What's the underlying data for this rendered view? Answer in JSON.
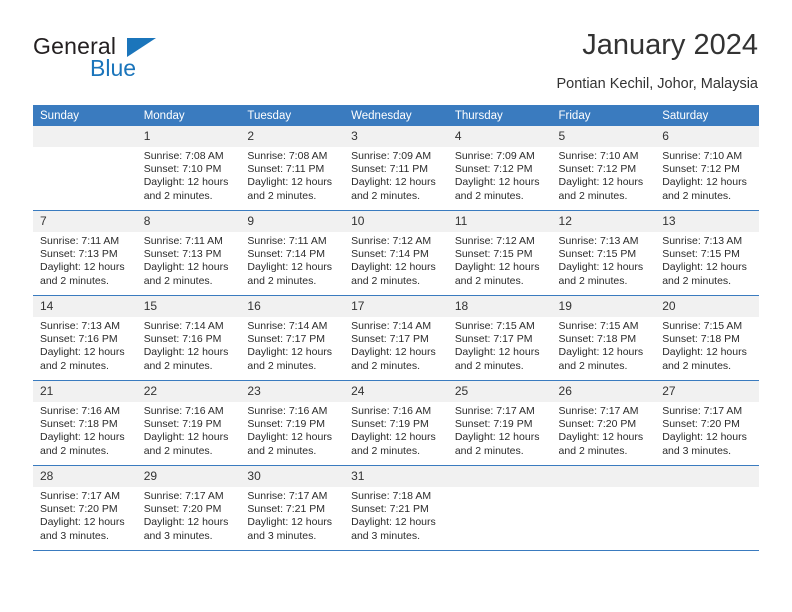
{
  "brand": {
    "name_part1": "General",
    "name_part2": "Blue",
    "triangle_icon": "triangle-icon",
    "accent_color": "#1b75bb"
  },
  "header": {
    "title": "January 2024",
    "subtitle": "Pontian Kechil, Johor, Malaysia"
  },
  "calendar": {
    "header_color": "#3a7bbf",
    "daynum_background": "#f1f1f1",
    "weekday_headers": [
      "Sunday",
      "Monday",
      "Tuesday",
      "Wednesday",
      "Thursday",
      "Friday",
      "Saturday"
    ],
    "weeks": [
      [
        {
          "day": "",
          "sunrise": "",
          "sunset": "",
          "daylight_line1": "",
          "daylight_line2": ""
        },
        {
          "day": "1",
          "sunrise": "Sunrise: 7:08 AM",
          "sunset": "Sunset: 7:10 PM",
          "daylight_line1": "Daylight: 12 hours",
          "daylight_line2": "and 2 minutes."
        },
        {
          "day": "2",
          "sunrise": "Sunrise: 7:08 AM",
          "sunset": "Sunset: 7:11 PM",
          "daylight_line1": "Daylight: 12 hours",
          "daylight_line2": "and 2 minutes."
        },
        {
          "day": "3",
          "sunrise": "Sunrise: 7:09 AM",
          "sunset": "Sunset: 7:11 PM",
          "daylight_line1": "Daylight: 12 hours",
          "daylight_line2": "and 2 minutes."
        },
        {
          "day": "4",
          "sunrise": "Sunrise: 7:09 AM",
          "sunset": "Sunset: 7:12 PM",
          "daylight_line1": "Daylight: 12 hours",
          "daylight_line2": "and 2 minutes."
        },
        {
          "day": "5",
          "sunrise": "Sunrise: 7:10 AM",
          "sunset": "Sunset: 7:12 PM",
          "daylight_line1": "Daylight: 12 hours",
          "daylight_line2": "and 2 minutes."
        },
        {
          "day": "6",
          "sunrise": "Sunrise: 7:10 AM",
          "sunset": "Sunset: 7:12 PM",
          "daylight_line1": "Daylight: 12 hours",
          "daylight_line2": "and 2 minutes."
        }
      ],
      [
        {
          "day": "7",
          "sunrise": "Sunrise: 7:11 AM",
          "sunset": "Sunset: 7:13 PM",
          "daylight_line1": "Daylight: 12 hours",
          "daylight_line2": "and 2 minutes."
        },
        {
          "day": "8",
          "sunrise": "Sunrise: 7:11 AM",
          "sunset": "Sunset: 7:13 PM",
          "daylight_line1": "Daylight: 12 hours",
          "daylight_line2": "and 2 minutes."
        },
        {
          "day": "9",
          "sunrise": "Sunrise: 7:11 AM",
          "sunset": "Sunset: 7:14 PM",
          "daylight_line1": "Daylight: 12 hours",
          "daylight_line2": "and 2 minutes."
        },
        {
          "day": "10",
          "sunrise": "Sunrise: 7:12 AM",
          "sunset": "Sunset: 7:14 PM",
          "daylight_line1": "Daylight: 12 hours",
          "daylight_line2": "and 2 minutes."
        },
        {
          "day": "11",
          "sunrise": "Sunrise: 7:12 AM",
          "sunset": "Sunset: 7:15 PM",
          "daylight_line1": "Daylight: 12 hours",
          "daylight_line2": "and 2 minutes."
        },
        {
          "day": "12",
          "sunrise": "Sunrise: 7:13 AM",
          "sunset": "Sunset: 7:15 PM",
          "daylight_line1": "Daylight: 12 hours",
          "daylight_line2": "and 2 minutes."
        },
        {
          "day": "13",
          "sunrise": "Sunrise: 7:13 AM",
          "sunset": "Sunset: 7:15 PM",
          "daylight_line1": "Daylight: 12 hours",
          "daylight_line2": "and 2 minutes."
        }
      ],
      [
        {
          "day": "14",
          "sunrise": "Sunrise: 7:13 AM",
          "sunset": "Sunset: 7:16 PM",
          "daylight_line1": "Daylight: 12 hours",
          "daylight_line2": "and 2 minutes."
        },
        {
          "day": "15",
          "sunrise": "Sunrise: 7:14 AM",
          "sunset": "Sunset: 7:16 PM",
          "daylight_line1": "Daylight: 12 hours",
          "daylight_line2": "and 2 minutes."
        },
        {
          "day": "16",
          "sunrise": "Sunrise: 7:14 AM",
          "sunset": "Sunset: 7:17 PM",
          "daylight_line1": "Daylight: 12 hours",
          "daylight_line2": "and 2 minutes."
        },
        {
          "day": "17",
          "sunrise": "Sunrise: 7:14 AM",
          "sunset": "Sunset: 7:17 PM",
          "daylight_line1": "Daylight: 12 hours",
          "daylight_line2": "and 2 minutes."
        },
        {
          "day": "18",
          "sunrise": "Sunrise: 7:15 AM",
          "sunset": "Sunset: 7:17 PM",
          "daylight_line1": "Daylight: 12 hours",
          "daylight_line2": "and 2 minutes."
        },
        {
          "day": "19",
          "sunrise": "Sunrise: 7:15 AM",
          "sunset": "Sunset: 7:18 PM",
          "daylight_line1": "Daylight: 12 hours",
          "daylight_line2": "and 2 minutes."
        },
        {
          "day": "20",
          "sunrise": "Sunrise: 7:15 AM",
          "sunset": "Sunset: 7:18 PM",
          "daylight_line1": "Daylight: 12 hours",
          "daylight_line2": "and 2 minutes."
        }
      ],
      [
        {
          "day": "21",
          "sunrise": "Sunrise: 7:16 AM",
          "sunset": "Sunset: 7:18 PM",
          "daylight_line1": "Daylight: 12 hours",
          "daylight_line2": "and 2 minutes."
        },
        {
          "day": "22",
          "sunrise": "Sunrise: 7:16 AM",
          "sunset": "Sunset: 7:19 PM",
          "daylight_line1": "Daylight: 12 hours",
          "daylight_line2": "and 2 minutes."
        },
        {
          "day": "23",
          "sunrise": "Sunrise: 7:16 AM",
          "sunset": "Sunset: 7:19 PM",
          "daylight_line1": "Daylight: 12 hours",
          "daylight_line2": "and 2 minutes."
        },
        {
          "day": "24",
          "sunrise": "Sunrise: 7:16 AM",
          "sunset": "Sunset: 7:19 PM",
          "daylight_line1": "Daylight: 12 hours",
          "daylight_line2": "and 2 minutes."
        },
        {
          "day": "25",
          "sunrise": "Sunrise: 7:17 AM",
          "sunset": "Sunset: 7:19 PM",
          "daylight_line1": "Daylight: 12 hours",
          "daylight_line2": "and 2 minutes."
        },
        {
          "day": "26",
          "sunrise": "Sunrise: 7:17 AM",
          "sunset": "Sunset: 7:20 PM",
          "daylight_line1": "Daylight: 12 hours",
          "daylight_line2": "and 2 minutes."
        },
        {
          "day": "27",
          "sunrise": "Sunrise: 7:17 AM",
          "sunset": "Sunset: 7:20 PM",
          "daylight_line1": "Daylight: 12 hours",
          "daylight_line2": "and 3 minutes."
        }
      ],
      [
        {
          "day": "28",
          "sunrise": "Sunrise: 7:17 AM",
          "sunset": "Sunset: 7:20 PM",
          "daylight_line1": "Daylight: 12 hours",
          "daylight_line2": "and 3 minutes."
        },
        {
          "day": "29",
          "sunrise": "Sunrise: 7:17 AM",
          "sunset": "Sunset: 7:20 PM",
          "daylight_line1": "Daylight: 12 hours",
          "daylight_line2": "and 3 minutes."
        },
        {
          "day": "30",
          "sunrise": "Sunrise: 7:17 AM",
          "sunset": "Sunset: 7:21 PM",
          "daylight_line1": "Daylight: 12 hours",
          "daylight_line2": "and 3 minutes."
        },
        {
          "day": "31",
          "sunrise": "Sunrise: 7:18 AM",
          "sunset": "Sunset: 7:21 PM",
          "daylight_line1": "Daylight: 12 hours",
          "daylight_line2": "and 3 minutes."
        },
        {
          "day": "",
          "sunrise": "",
          "sunset": "",
          "daylight_line1": "",
          "daylight_line2": ""
        },
        {
          "day": "",
          "sunrise": "",
          "sunset": "",
          "daylight_line1": "",
          "daylight_line2": ""
        },
        {
          "day": "",
          "sunrise": "",
          "sunset": "",
          "daylight_line1": "",
          "daylight_line2": ""
        }
      ]
    ]
  }
}
